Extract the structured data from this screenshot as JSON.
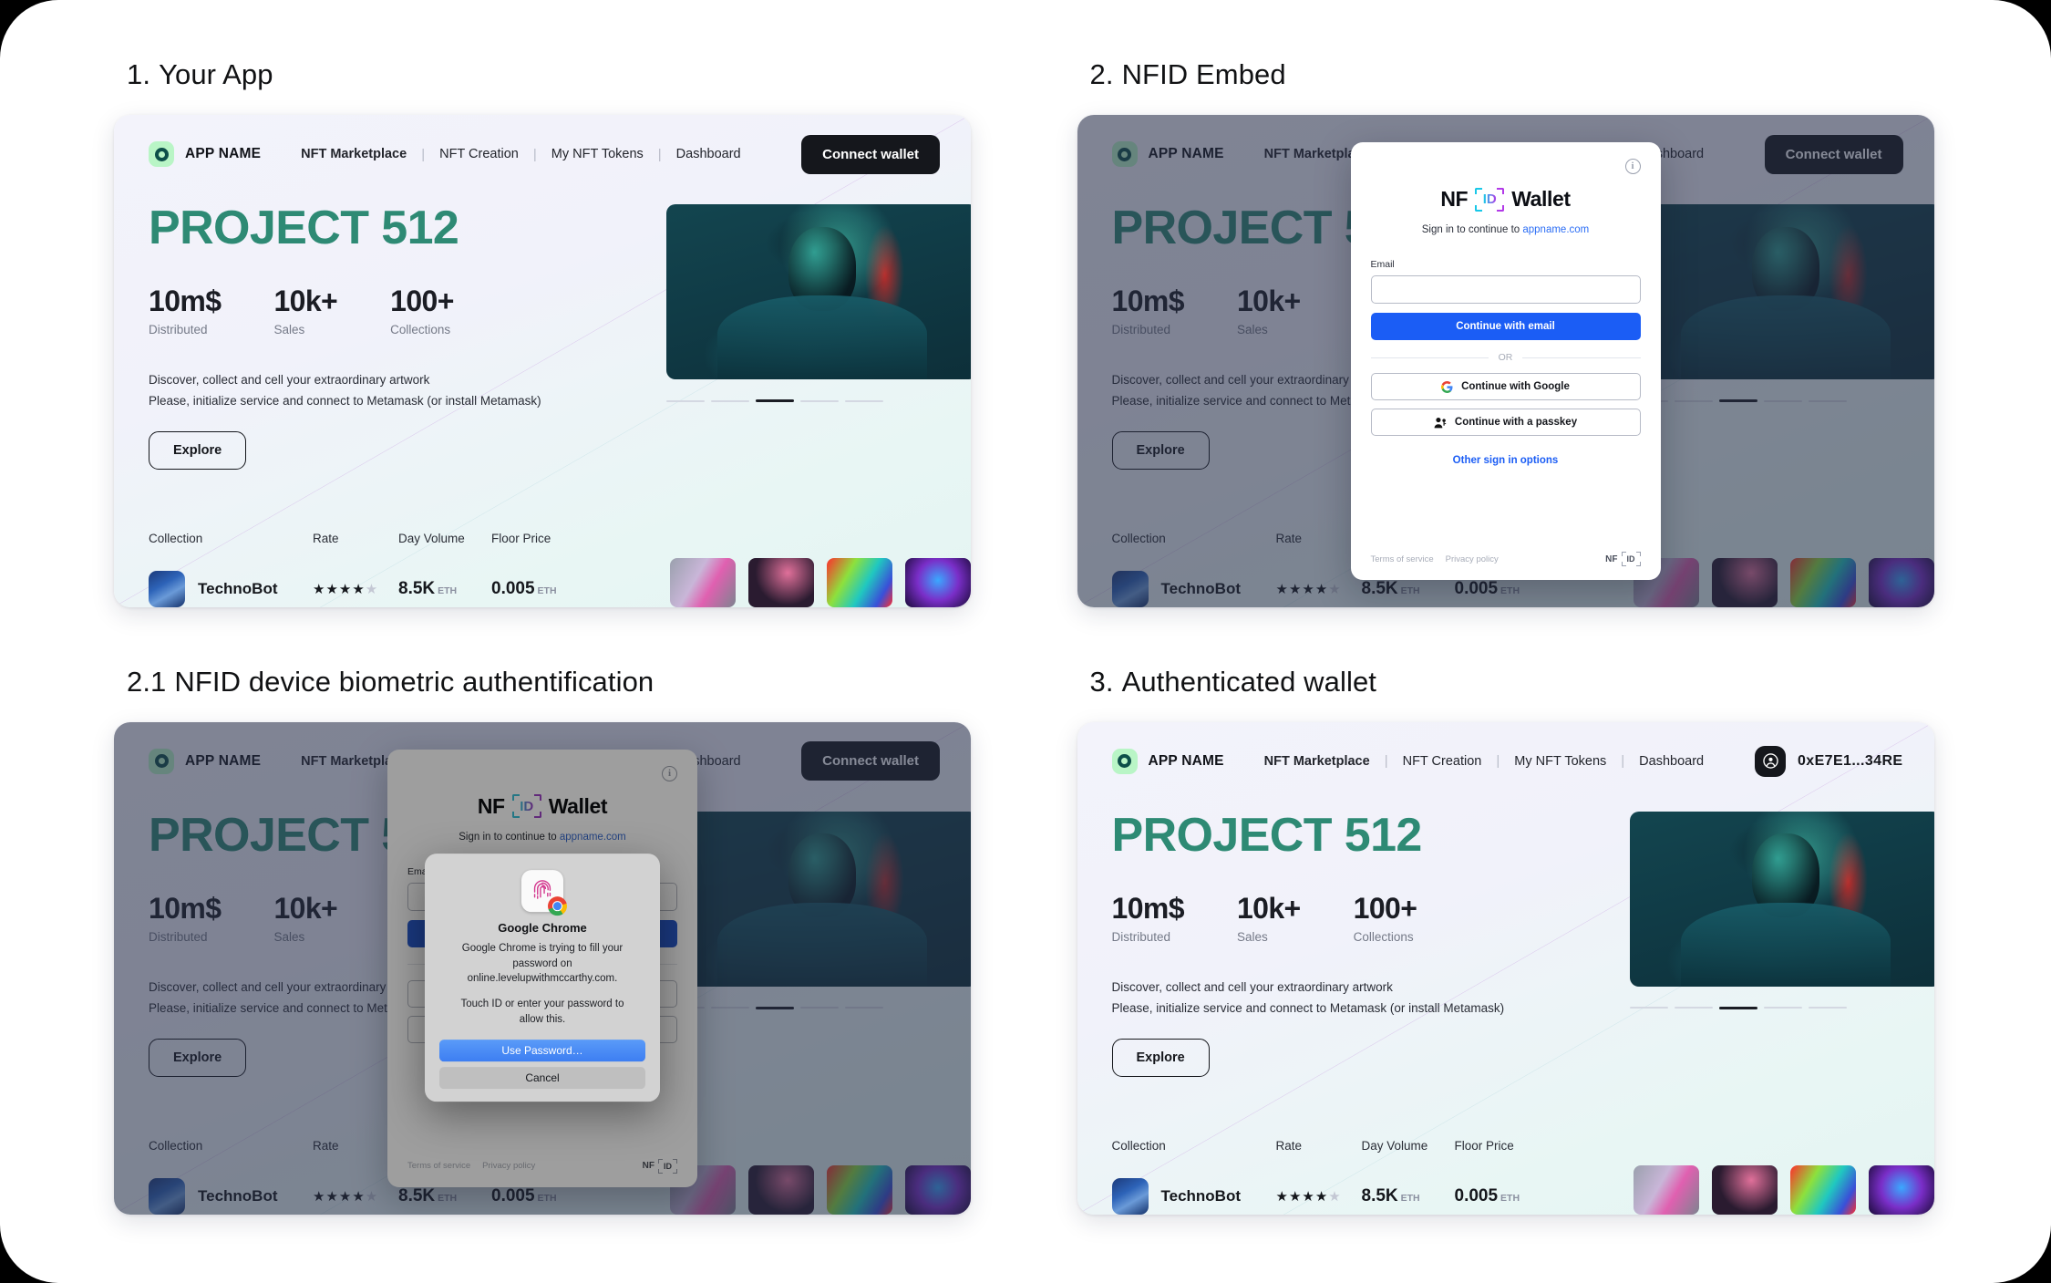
{
  "panels": [
    {
      "num": "1.",
      "title": "Your App"
    },
    {
      "num": "2.",
      "title": "NFID Embed"
    },
    {
      "num": "2.1",
      "title": "NFID device biometric authentification"
    },
    {
      "num": "3.",
      "title": "Authenticated wallet"
    }
  ],
  "app": {
    "brand": "APP NAME",
    "nav": [
      {
        "label": "NFT Marketplace",
        "active": true
      },
      {
        "label": "NFT Creation",
        "active": false
      },
      {
        "label": "My NFT Tokens",
        "active": false
      },
      {
        "label": "Dashboard",
        "active": false
      }
    ],
    "connect_label": "Connect wallet",
    "wallet_address": "0xE7E1...34RE",
    "hero_title": "PROJECT 512",
    "stats": [
      {
        "value": "10m$",
        "label": "Distributed"
      },
      {
        "value": "10k+",
        "label": "Sales"
      },
      {
        "value": "100+",
        "label": "Collections"
      }
    ],
    "description_lines": [
      "Discover, collect and cell your extraordinary artwork",
      "Please, initialize service and connect to Metamask (or install Metamask)"
    ],
    "explore_label": "Explore",
    "carousel": {
      "count": 5,
      "active_index": 2
    },
    "table": {
      "headers": [
        "Collection",
        "Rate",
        "Day Volume",
        "Floor Price"
      ],
      "rows": [
        {
          "collection": "TechnoBot",
          "rate_filled": 4,
          "rate_total": 5,
          "day_volume": "8.5K",
          "day_volume_unit": "ETH",
          "floor_price": "0.005",
          "floor_price_unit": "ETH"
        }
      ]
    }
  },
  "nfid_modal": {
    "info_icon": "info-icon",
    "logo_nf": "NF",
    "logo_id": "ID",
    "logo_wallet": "Wallet",
    "signin_prefix": "Sign in to continue to ",
    "signin_domain": "appname.com",
    "email_label": "Email",
    "email_value": "",
    "continue_email_label": "Continue with email",
    "or_label": "OR",
    "google_label": "Continue with Google",
    "passkey_label": "Continue with a passkey",
    "other_options_label": "Other sign in options",
    "terms_label": "Terms of service",
    "privacy_label": "Privacy policy",
    "foot_nf": "NF",
    "foot_id": "ID"
  },
  "touchid_dialog": {
    "title": "Google Chrome",
    "body_line1": "Google Chrome is trying to fill your",
    "body_line2": "password on",
    "body_line3": "online.levelupwithmccarthy.com.",
    "body_line4": "Touch ID or enter your password to",
    "body_line5": "allow this.",
    "use_password_label": "Use Password…",
    "cancel_label": "Cancel"
  },
  "colors": {
    "brand_green": "#2e8a74",
    "logo_badge": "#b9f5c6",
    "primary_blue": "#1b5df5",
    "dark": "#15171c"
  }
}
